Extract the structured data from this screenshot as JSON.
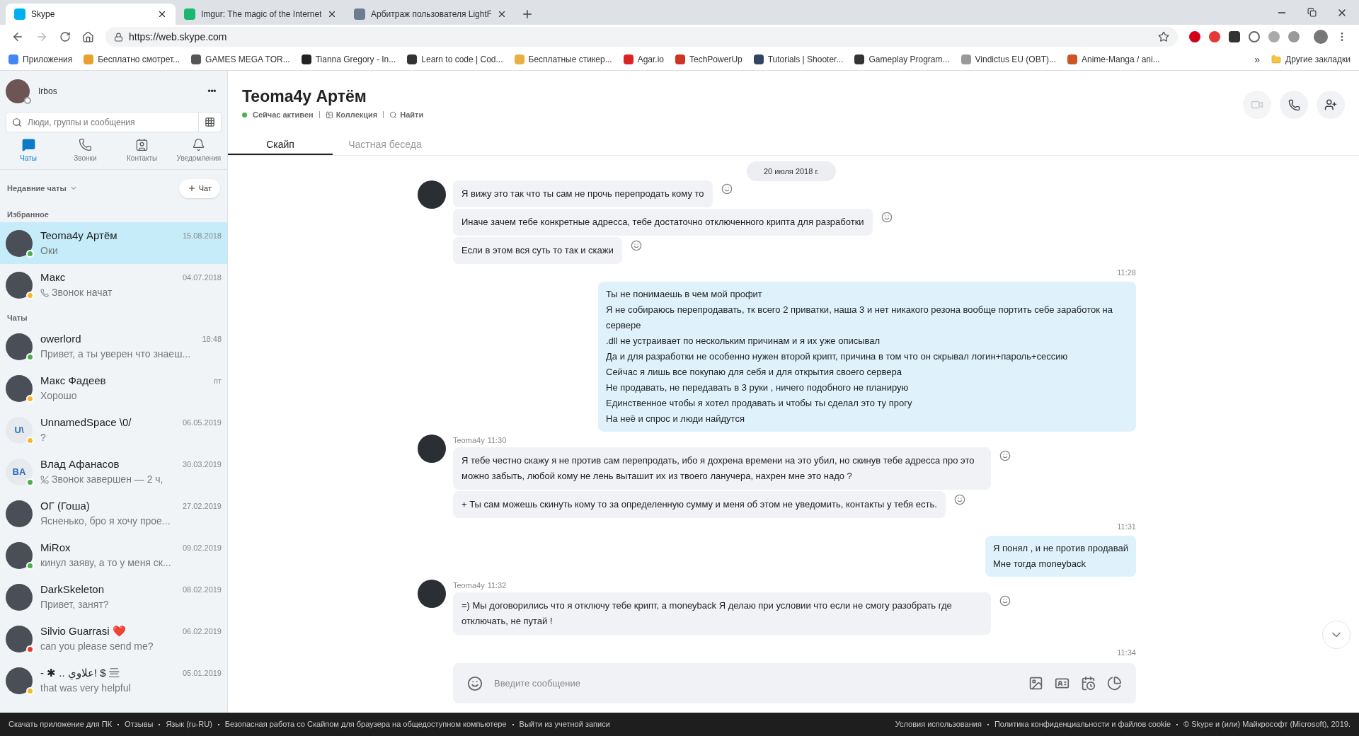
{
  "browser": {
    "tabs": [
      {
        "title": "Skype",
        "selected": true
      },
      {
        "title": "Imgur: The magic of the Internet",
        "selected": false
      },
      {
        "title": "Арбитраж пользователя LightF",
        "selected": false
      }
    ],
    "url": "https://web.skype.com",
    "bookmarks": [
      {
        "label": "Приложения",
        "color": "#4285f4"
      },
      {
        "label": "Бесплатно смотрет...",
        "color": "#e8a030"
      },
      {
        "label": "GAMES MEGA TOR...",
        "color": "#555555"
      },
      {
        "label": "Tianna Gregory - In...",
        "color": "#222222"
      },
      {
        "label": "Learn to code | Cod...",
        "color": "#333333"
      },
      {
        "label": "Бесплатные стикер...",
        "color": "#e8b040"
      },
      {
        "label": "Agar.io",
        "color": "#dd2222"
      },
      {
        "label": "TechPowerUp",
        "color": "#cc3322"
      },
      {
        "label": "Tutorials | Shooter...",
        "color": "#334466"
      },
      {
        "label": "Gameplay Program...",
        "color": "#333333"
      },
      {
        "label": "Vindictus EU (OBT)...",
        "color": "#999999"
      },
      {
        "label": "Anime-Manga / ani...",
        "color": "#cc5522"
      }
    ],
    "more": "»",
    "other": "Другие закладки"
  },
  "sidebar": {
    "user": {
      "name": "Irbos",
      "color": "#9aa0a6"
    },
    "more": "•••",
    "search": {
      "placeholder": "Люди, группы и сообщения"
    },
    "nav": [
      {
        "label": "Чаты",
        "selected": true
      },
      {
        "label": "Звонки",
        "selected": false
      },
      {
        "label": "Контакты",
        "selected": false
      },
      {
        "label": "Уведомления",
        "selected": false
      }
    ],
    "recent": "Недавние чаты",
    "new_chat": "Чат",
    "sections": [
      {
        "title": "Избранное",
        "chats": [
          {
            "name": "Teoma4y Артём",
            "time": "15.08.2018",
            "preview": "Оки",
            "selected": true,
            "color": "#4caf50",
            "kind": "text"
          },
          {
            "name": "Макс",
            "time": "04.07.2018",
            "preview": "Звонок начат",
            "kind": "call",
            "selected": false,
            "color": "#f8b62d"
          }
        ]
      },
      {
        "title": "Чаты",
        "chats": [
          {
            "name": "owerlord",
            "time": "18:48",
            "preview": "Привет, а ты уверен что знаеш...",
            "selected": false,
            "color": "#4caf50",
            "kind": "text"
          },
          {
            "name": "Макс Фадеев",
            "time": "пт",
            "preview": "Хорошо",
            "selected": false,
            "color": "#f8b62d",
            "kind": "text"
          },
          {
            "name": "UnnamedSpace \\0/",
            "time": "06.05.2019",
            "preview": "?",
            "selected": false,
            "color": "#f8b62d",
            "kind": "text",
            "initials": "U\\"
          },
          {
            "name": "Влад Афанасов",
            "time": "30.03.2019",
            "preview": "Звонок завершен — 2 ч,",
            "kind": "call-ended",
            "selected": false,
            "color": "#4caf50",
            "initials": "BA"
          },
          {
            "name": "ОГ (Гоша)",
            "time": "27.02.2019",
            "preview": "Ясненько, бро я хочу прое...",
            "selected": false,
            "kind": "text"
          },
          {
            "name": "MiRox",
            "time": "09.02.2019",
            "preview": "кинул заяву, а то у меня ск...",
            "selected": false,
            "color": "#4caf50",
            "kind": "text"
          },
          {
            "name": "DarkSkeleton",
            "time": "08.02.2019",
            "preview": "Привет, занят?",
            "selected": false,
            "kind": "text"
          },
          {
            "name": "Silvio Guarrasi",
            "emoji": "❤️",
            "time": "06.02.2019",
            "preview": "can you please send me?",
            "selected": false,
            "color": "#e53935",
            "kind": "text"
          },
          {
            "name": "- ✱ .. علاوي! $ 亖",
            "time": "05.01.2019",
            "preview": "that was very helpful",
            "selected": false,
            "color": "#f8b62d",
            "kind": "text"
          }
        ]
      }
    ]
  },
  "chat": {
    "title": "Teoma4y Артём",
    "status": "Сейчас активен",
    "links": [
      "Коллекция",
      "Найти"
    ],
    "tabs": [
      {
        "label": "Скайп",
        "selected": true
      },
      {
        "label": "Частная беседа",
        "selected": false
      }
    ],
    "date_pill": "20 июля 2018 г.",
    "messages": [
      {
        "kind": "incoming",
        "bubbles": [
          "Я вижу это так что ты сам не прочь перепродать кому то",
          "Иначе зачем тебе конкретные адресса, тебе достаточно отключенного крипта для разработки",
          "Если в этом вся суть то так и скажи"
        ]
      },
      {
        "kind": "outgoing",
        "time": "11:28",
        "lines": [
          "Ты не понимаешь в чем мой профит",
          "Я не собираюсь перепродавать, тк всего 2 приватки, наша 3 и нет никакого резона вообще портить себе заработок на сервере",
          ".dll не устраивает по нескольким причинам и я их уже описывал",
          "Да и для разработки не особенно нужен второй крипт, причина в том что он скрывал логин+пароль+сессию",
          "Сейчас я лишь все покупаю для себя и для открытия своего сервера",
          "Не продавать, не передавать в 3 руки , ничего подобного не планирую",
          "Единственное чтобы я хотел продавать и чтобы ты сделал это ту прогу",
          "На неё и спрос и люди найдутся"
        ]
      },
      {
        "kind": "incoming",
        "sender": "Teoma4y",
        "time": "11:30",
        "bubbles": [
          "Я тебе честно скажу я не против сам перепродать, ибо я дохрена времени на это убил, но скинув тебе адресса про это можно забыть, любой кому не лень выташит их из твоего ланучера, нахрен мне это надо ?",
          "+ Ты сам можешь скинуть кому то за определенную сумму и меня об этом не уведомить, контакты у тебя есть."
        ]
      },
      {
        "kind": "outgoing",
        "time": "11:31",
        "lines": [
          "Я понял , и не против продавай",
          "Мне тогда moneyback"
        ]
      },
      {
        "kind": "incoming",
        "sender": "Teoma4y",
        "time": "11:32",
        "bubbles": [
          "=) Мы договорились что я отключу тебе крипт, а moneyback Я делаю при условии что если не смогу разобрать где отключать, не путай !"
        ]
      }
    ],
    "last_time": "11:34",
    "input": {
      "placeholder": "Введите сообщение"
    }
  },
  "footer": {
    "left": [
      "Скачать приложение для ПК",
      "Отзывы",
      "Язык (ru-RU)",
      "Безопасная работа со Скайпом для браузера на общедоступном компьютере",
      "Выйти из учетной записи"
    ],
    "right": [
      "Условия использования",
      "Политика конфиденциальности и файлов cookie",
      "© Skype и (или) Майкрософт (Microsoft), 2019."
    ]
  }
}
